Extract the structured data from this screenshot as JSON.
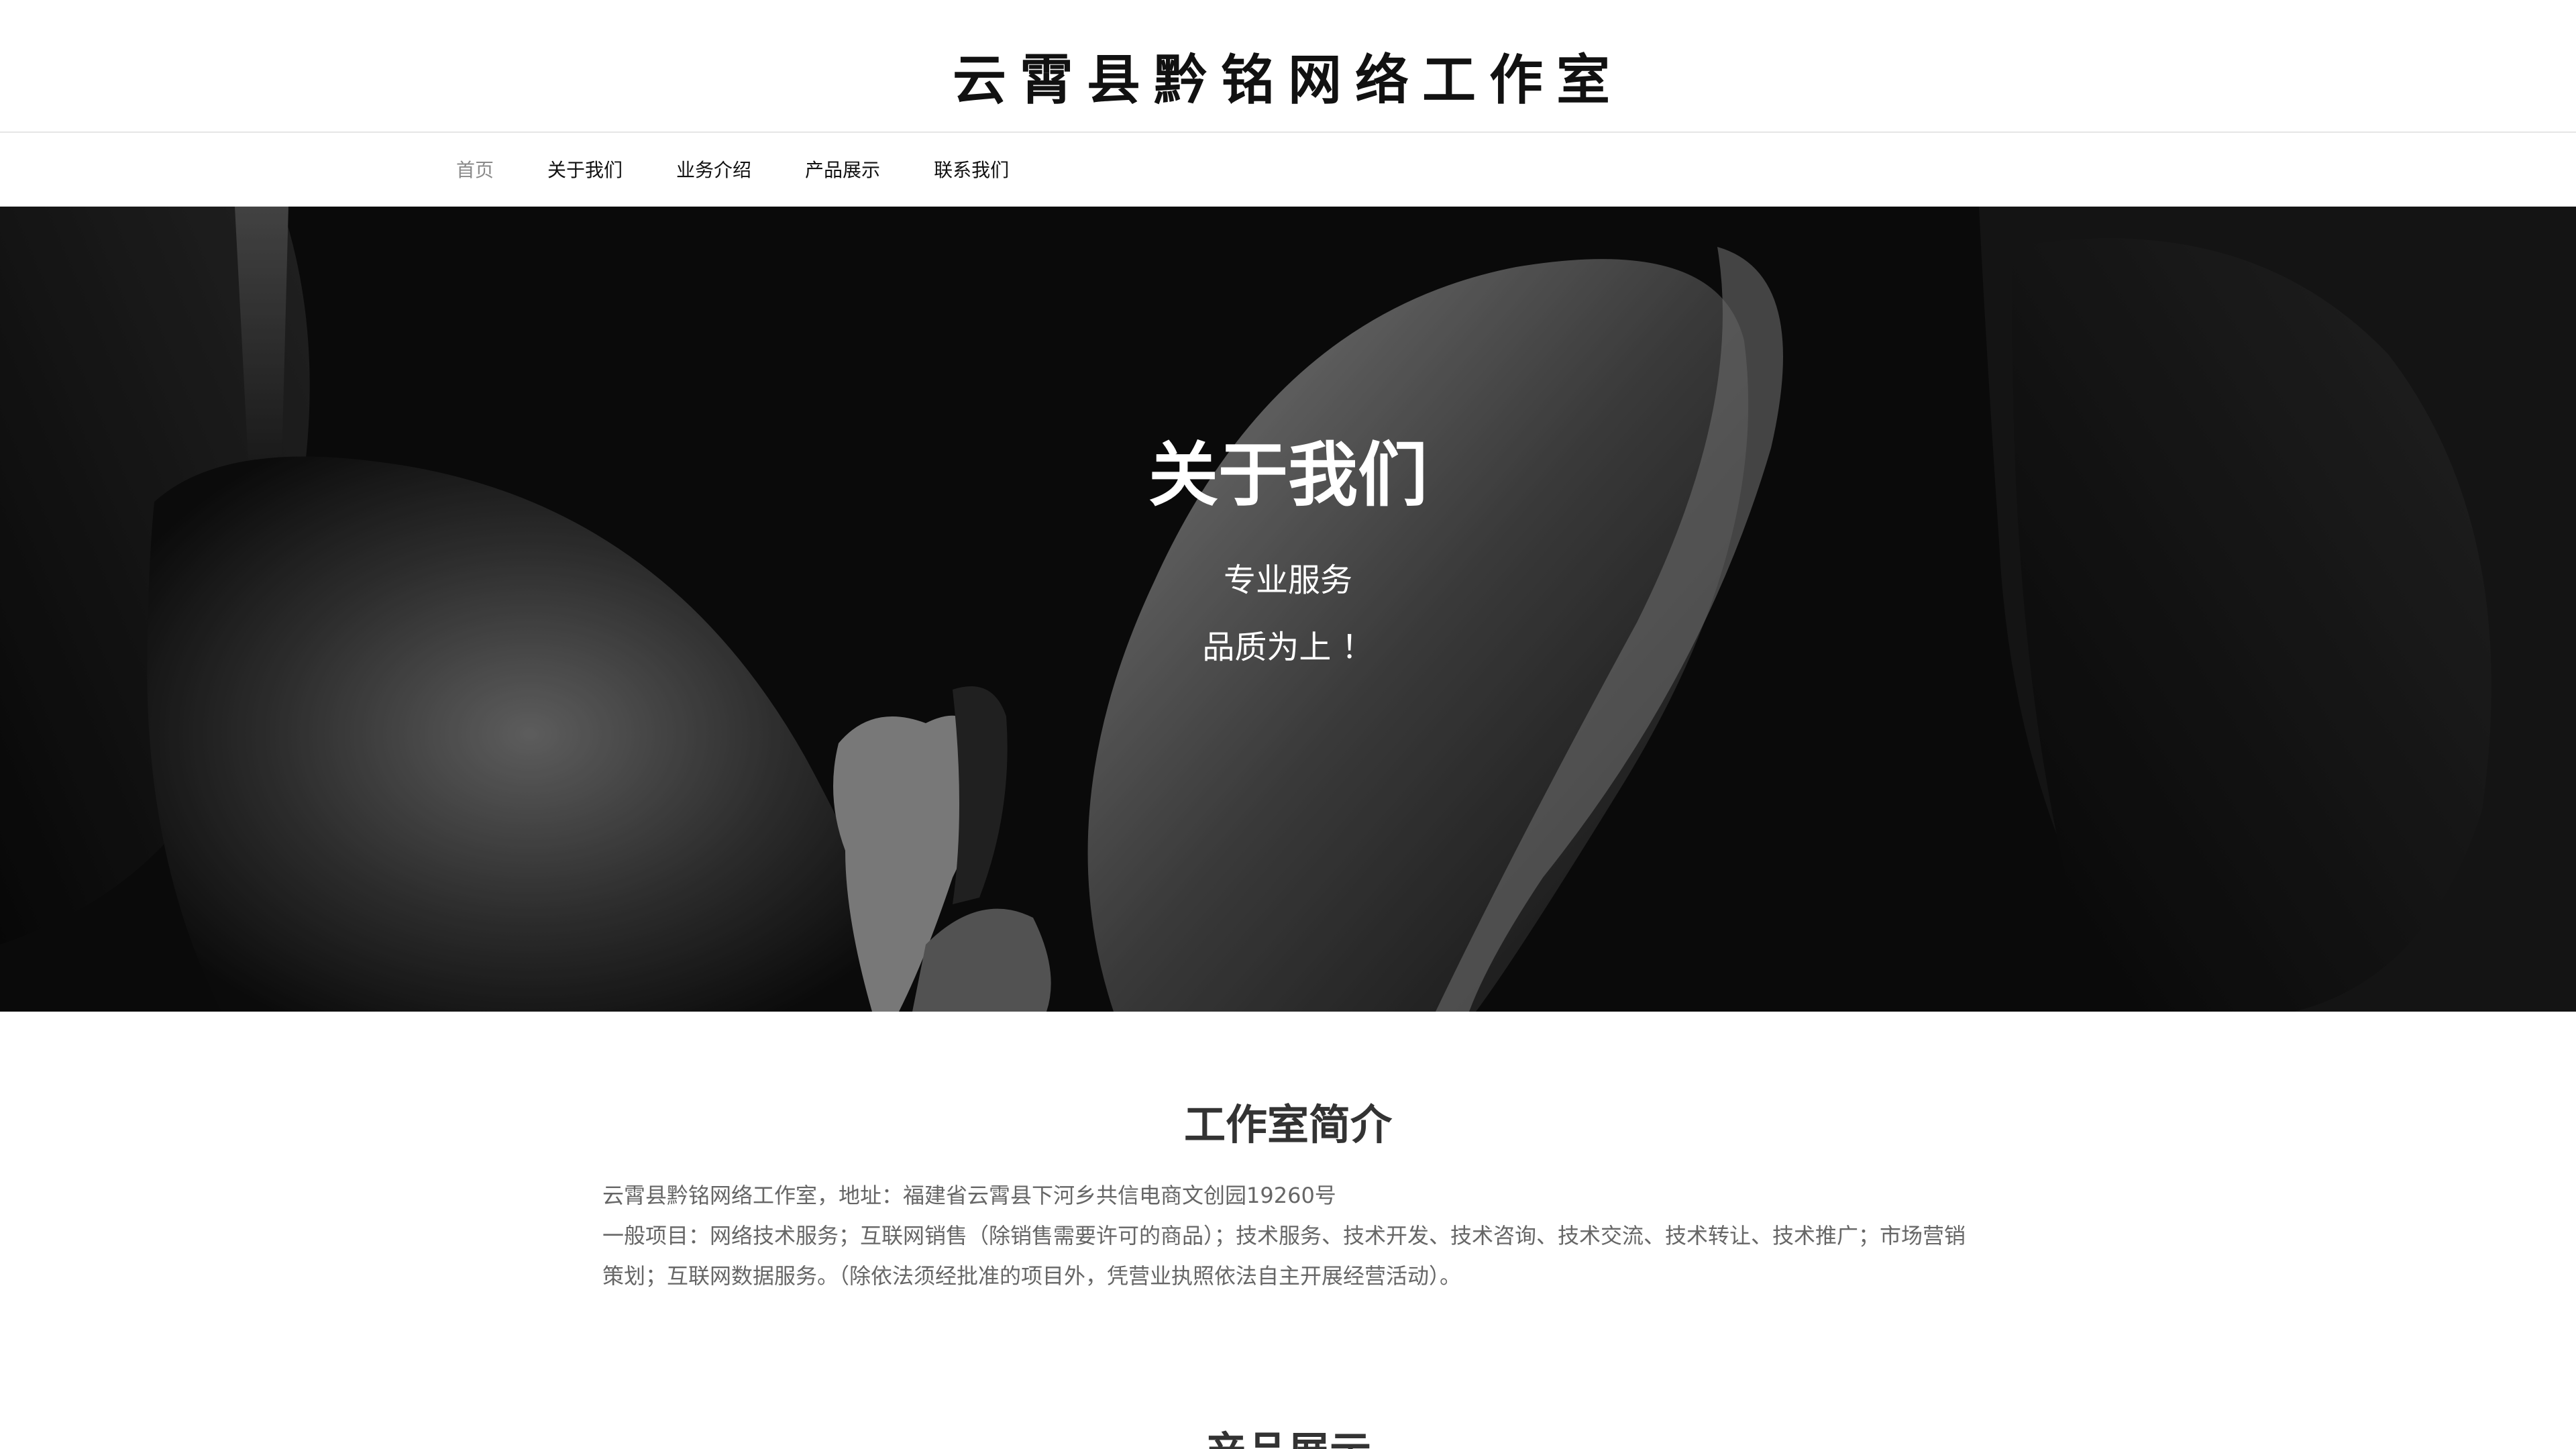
{
  "header": {
    "site_title": "云霄县黔铭网络工作室"
  },
  "nav": {
    "items": [
      {
        "label": "首页",
        "active": true
      },
      {
        "label": "关于我们",
        "active": false
      },
      {
        "label": "业务介绍",
        "active": false
      },
      {
        "label": "产品展示",
        "active": false
      },
      {
        "label": "联系我们",
        "active": false
      }
    ]
  },
  "hero": {
    "title": "关于我们",
    "line1": "专业服务",
    "line2": "品质为上 ！",
    "image_desc": "black-and-white tulip petals"
  },
  "intro": {
    "title": "工作室简介",
    "paragraph1": "云霄县黔铭网络工作室，地址：福建省云霄县下河乡共信电商文创园19260号",
    "paragraph2": "一般项目：网络技术服务；互联网销售（除销售需要许可的商品）；技术服务、技术开发、技术咨询、技术交流、技术转让、技术推广；市场营销策划；互联网数据服务。（除依法须经批准的项目外，凭营业执照依法自主开展经营活动）。"
  },
  "products": {
    "title": "产品展示"
  },
  "colors": {
    "nav_active": "#8a8a8a",
    "text_main": "#111111",
    "text_body": "#666666",
    "hero_bg": "#0c0c0c"
  }
}
